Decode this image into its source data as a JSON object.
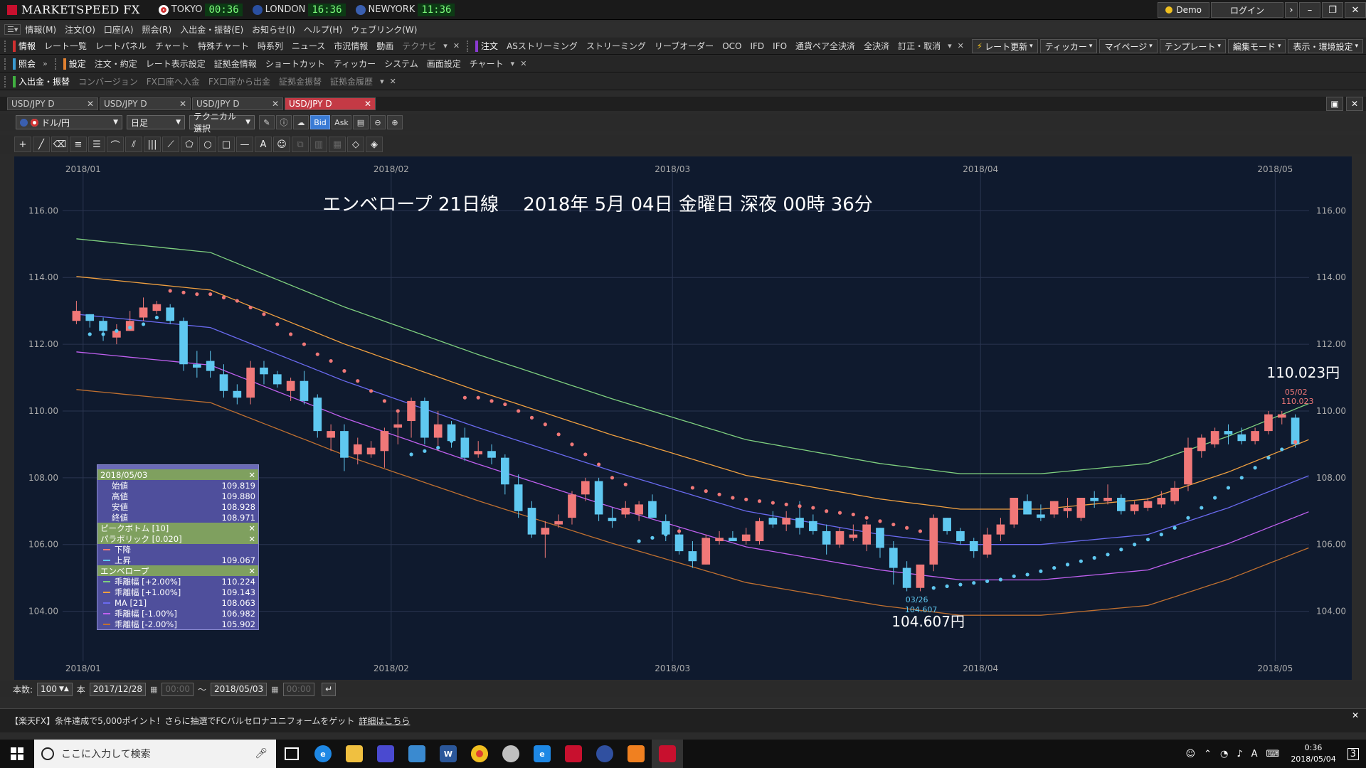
{
  "titlebar": {
    "brand": "MARKETSPEED FX",
    "markets": [
      {
        "name": "TOKYO",
        "time": "00:36",
        "color": "#d03030"
      },
      {
        "name": "LONDON",
        "time": "16:36",
        "color": "#2a4fa0"
      },
      {
        "name": "NEWYORK",
        "time": "11:36",
        "color": "#3a5fb0"
      }
    ],
    "demo_label": "Demo",
    "login_label": "ログイン"
  },
  "menu": [
    "情報(M)",
    "注文(O)",
    "口座(A)",
    "照会(R)",
    "入出金・振替(E)",
    "お知らせ(I)",
    "ヘルプ(H)",
    "ウェブリンク(W)"
  ],
  "toolbar1": {
    "info_head": "情報",
    "info_items": [
      "レート一覧",
      "レートパネル",
      "チャート",
      "特殊チャート",
      "時系列",
      "ニュース",
      "市況情報",
      "動画",
      "テクナビ"
    ],
    "order_head": "注文",
    "order_items": [
      "ASストリーミング",
      "ストリーミング",
      "リーブオーダー",
      "OCO",
      "IFD",
      "IFO",
      "通貨ペア全決済",
      "全決済",
      "訂正・取消"
    ],
    "right_buttons": [
      "レート更新",
      "ティッカー",
      "マイページ",
      "テンプレート",
      "編集モード",
      "表示・環境設定"
    ]
  },
  "toolbar2": {
    "inquiry_head": "照会",
    "settings_head": "設定",
    "settings_items": [
      "注文・約定",
      "レート表示設定",
      "証拠金情報",
      "ショートカット",
      "ティッカー",
      "システム",
      "画面設定",
      "チャート"
    ]
  },
  "toolbar3": {
    "deposit_head": "入出金・振替",
    "deposit_items": [
      "コンバージョン",
      "FX口座へ入金",
      "FX口座から出金",
      "証拠金振替",
      "証拠金履歴"
    ]
  },
  "tabs": [
    {
      "label": "USD/JPY D",
      "active": false
    },
    {
      "label": "USD/JPY D",
      "active": false
    },
    {
      "label": "USD/JPY D",
      "active": false
    },
    {
      "label": "USD/JPY D",
      "active": true
    }
  ],
  "chart_controls": {
    "pair": "ドル/円",
    "timeframe": "日足",
    "technical": "テクニカル選択",
    "bid_label": "Bid",
    "ask_label": "Ask"
  },
  "chart_data": {
    "type": "candlestick",
    "title": "エンベロープ 21日線　 2018年 5月 04日 金曜日 深夜 00時 36分",
    "x_labels": [
      "2018/01",
      "2018/02",
      "2018/03",
      "2018/04",
      "2018/05"
    ],
    "x_label_index": [
      1,
      24,
      45,
      68,
      90
    ],
    "ylim": [
      102.5,
      117.2
    ],
    "yticks": [
      "116.00",
      "114.00",
      "112.00",
      "110.00",
      "108.00",
      "106.00",
      "104.00"
    ],
    "ytick_values": [
      116,
      114,
      112,
      110,
      108,
      106,
      104
    ],
    "ohlc": [
      [
        112.7,
        113.3,
        112.6,
        113.0
      ],
      [
        112.9,
        112.9,
        112.5,
        112.7
      ],
      [
        112.7,
        112.8,
        112.1,
        112.4
      ],
      [
        112.2,
        112.6,
        112.0,
        112.4
      ],
      [
        112.4,
        113.0,
        112.4,
        112.7
      ],
      [
        112.8,
        113.4,
        112.7,
        113.1
      ],
      [
        113.0,
        113.3,
        112.9,
        113.2
      ],
      [
        113.1,
        113.2,
        112.6,
        112.7
      ],
      [
        112.7,
        112.8,
        111.2,
        111.4
      ],
      [
        111.4,
        111.8,
        111.0,
        111.3
      ],
      [
        111.5,
        111.8,
        111.0,
        111.2
      ],
      [
        111.1,
        111.4,
        110.4,
        110.6
      ],
      [
        110.6,
        110.8,
        110.2,
        110.4
      ],
      [
        110.4,
        111.5,
        110.2,
        111.3
      ],
      [
        111.3,
        111.5,
        110.8,
        111.1
      ],
      [
        111.1,
        111.2,
        110.7,
        110.8
      ],
      [
        110.6,
        111.0,
        110.3,
        110.9
      ],
      [
        110.9,
        111.2,
        110.2,
        110.3
      ],
      [
        110.4,
        110.5,
        109.2,
        109.4
      ],
      [
        109.2,
        109.6,
        108.8,
        109.4
      ],
      [
        109.4,
        109.6,
        108.2,
        108.6
      ],
      [
        108.7,
        109.2,
        108.4,
        109.0
      ],
      [
        108.7,
        109.1,
        108.6,
        108.9
      ],
      [
        108.8,
        109.5,
        108.3,
        109.4
      ],
      [
        109.5,
        110.0,
        109.0,
        109.6
      ],
      [
        109.7,
        110.4,
        109.2,
        110.3
      ],
      [
        110.3,
        110.4,
        109.0,
        109.2
      ],
      [
        109.2,
        110.0,
        108.8,
        109.6
      ],
      [
        109.6,
        109.7,
        108.9,
        109.1
      ],
      [
        109.2,
        109.5,
        108.5,
        108.6
      ],
      [
        108.7,
        109.1,
        108.6,
        108.8
      ],
      [
        108.8,
        109.0,
        108.4,
        108.6
      ],
      [
        108.6,
        108.7,
        107.5,
        107.8
      ],
      [
        107.8,
        108.1,
        106.8,
        107.0
      ],
      [
        107.1,
        107.3,
        106.2,
        106.3
      ],
      [
        106.3,
        106.7,
        105.6,
        106.5
      ],
      [
        106.6,
        106.9,
        106.5,
        106.7
      ],
      [
        106.8,
        107.6,
        106.6,
        107.5
      ],
      [
        107.5,
        108.0,
        107.3,
        107.9
      ],
      [
        107.9,
        108.0,
        106.7,
        106.9
      ],
      [
        106.8,
        107.1,
        106.5,
        106.7
      ],
      [
        106.9,
        107.3,
        106.8,
        107.1
      ],
      [
        106.9,
        107.3,
        106.7,
        107.2
      ],
      [
        107.3,
        107.5,
        106.8,
        106.8
      ],
      [
        106.7,
        106.9,
        106.1,
        106.3
      ],
      [
        106.3,
        106.5,
        105.7,
        105.8
      ],
      [
        105.8,
        106.1,
        105.3,
        105.5
      ],
      [
        105.4,
        106.3,
        105.4,
        106.2
      ],
      [
        106.1,
        106.4,
        106.0,
        106.2
      ],
      [
        106.2,
        106.4,
        106.1,
        106.1
      ],
      [
        106.1,
        106.5,
        106.0,
        106.3
      ],
      [
        106.1,
        106.8,
        106.0,
        106.7
      ],
      [
        106.8,
        107.0,
        106.5,
        106.6
      ],
      [
        106.6,
        107.0,
        106.4,
        106.8
      ],
      [
        106.8,
        107.3,
        106.3,
        106.5
      ],
      [
        106.7,
        106.9,
        106.3,
        106.4
      ],
      [
        106.4,
        106.6,
        105.7,
        106.0
      ],
      [
        106.0,
        106.5,
        105.9,
        106.4
      ],
      [
        106.2,
        106.6,
        106.1,
        106.3
      ],
      [
        106.0,
        106.7,
        105.8,
        106.6
      ],
      [
        106.5,
        106.5,
        105.6,
        105.9
      ],
      [
        105.9,
        106.1,
        104.8,
        105.3
      ],
      [
        105.3,
        105.5,
        104.6,
        104.7
      ],
      [
        104.7,
        105.3,
        104.6,
        105.4
      ],
      [
        105.4,
        106.9,
        105.2,
        106.8
      ],
      [
        106.8,
        106.8,
        106.3,
        106.4
      ],
      [
        106.4,
        106.5,
        106.0,
        106.1
      ],
      [
        106.1,
        106.2,
        105.6,
        105.8
      ],
      [
        105.7,
        106.5,
        105.6,
        106.3
      ],
      [
        106.3,
        106.8,
        106.1,
        106.6
      ],
      [
        106.6,
        107.4,
        106.5,
        107.4
      ],
      [
        107.3,
        107.5,
        106.9,
        106.9
      ],
      [
        106.9,
        107.2,
        106.7,
        106.8
      ],
      [
        106.9,
        107.3,
        106.8,
        107.3
      ],
      [
        107.0,
        107.4,
        106.8,
        107.1
      ],
      [
        106.8,
        107.4,
        106.7,
        107.4
      ],
      [
        107.4,
        107.6,
        107.1,
        107.3
      ],
      [
        107.3,
        107.8,
        107.2,
        107.4
      ],
      [
        107.4,
        107.5,
        106.9,
        107.0
      ],
      [
        107.0,
        107.3,
        106.9,
        107.2
      ],
      [
        107.1,
        107.4,
        107.0,
        107.3
      ],
      [
        107.2,
        107.6,
        107.1,
        107.4
      ],
      [
        107.3,
        107.9,
        107.2,
        107.7
      ],
      [
        107.8,
        109.2,
        107.6,
        108.9
      ],
      [
        108.8,
        109.3,
        108.6,
        109.2
      ],
      [
        109.0,
        109.5,
        108.9,
        109.4
      ],
      [
        109.4,
        109.6,
        109.0,
        109.3
      ],
      [
        109.3,
        109.5,
        109.0,
        109.1
      ],
      [
        109.1,
        109.5,
        109.0,
        109.4
      ],
      [
        109.4,
        110.0,
        109.3,
        109.9
      ],
      [
        109.8,
        110.0,
        109.6,
        109.9
      ],
      [
        109.8,
        109.9,
        108.9,
        109.0
      ]
    ],
    "parabolic_dots": [
      [
        1,
        112.3
      ],
      [
        2,
        112.3
      ],
      [
        3,
        112.4
      ],
      [
        4,
        112.5
      ],
      [
        5,
        112.6
      ],
      [
        6,
        112.8
      ],
      [
        7,
        113.6
      ],
      [
        8,
        113.55
      ],
      [
        9,
        113.5
      ],
      [
        10,
        113.5
      ],
      [
        11,
        113.4
      ],
      [
        12,
        113.3
      ],
      [
        13,
        113.1
      ],
      [
        14,
        112.9
      ],
      [
        15,
        112.6
      ],
      [
        16,
        112.3
      ],
      [
        17,
        112.0
      ],
      [
        18,
        111.7
      ],
      [
        19,
        111.5
      ],
      [
        20,
        111.2
      ],
      [
        21,
        110.9
      ],
      [
        22,
        110.6
      ],
      [
        23,
        110.3
      ],
      [
        24,
        110.0
      ],
      [
        25,
        108.7
      ],
      [
        26,
        108.8
      ],
      [
        27,
        108.9
      ],
      [
        28,
        109.1
      ],
      [
        29,
        110.4
      ],
      [
        30,
        110.4
      ],
      [
        31,
        110.3
      ],
      [
        32,
        110.2
      ],
      [
        33,
        110.0
      ],
      [
        34,
        109.8
      ],
      [
        35,
        109.6
      ],
      [
        36,
        109.3
      ],
      [
        37,
        109.0
      ],
      [
        38,
        108.7
      ],
      [
        39,
        108.4
      ],
      [
        40,
        108.0
      ],
      [
        41,
        107.8
      ],
      [
        42,
        106.1
      ],
      [
        43,
        106.2
      ],
      [
        44,
        106.3
      ],
      [
        45,
        106.4
      ],
      [
        46,
        107.7
      ],
      [
        47,
        107.6
      ],
      [
        48,
        107.5
      ],
      [
        49,
        107.4
      ],
      [
        50,
        107.35
      ],
      [
        51,
        107.3
      ],
      [
        52,
        107.25
      ],
      [
        53,
        107.2
      ],
      [
        54,
        107.15
      ],
      [
        55,
        107.1
      ],
      [
        56,
        107.0
      ],
      [
        57,
        106.95
      ],
      [
        58,
        106.9
      ],
      [
        59,
        106.8
      ],
      [
        60,
        106.7
      ],
      [
        61,
        106.6
      ],
      [
        62,
        106.5
      ],
      [
        63,
        106.4
      ],
      [
        64,
        104.7
      ],
      [
        65,
        104.75
      ],
      [
        66,
        104.8
      ],
      [
        67,
        104.85
      ],
      [
        68,
        104.9
      ],
      [
        69,
        104.95
      ],
      [
        70,
        105.05
      ],
      [
        71,
        105.1
      ],
      [
        72,
        105.2
      ],
      [
        73,
        105.3
      ],
      [
        74,
        105.4
      ],
      [
        75,
        105.5
      ],
      [
        76,
        105.6
      ],
      [
        77,
        105.7
      ],
      [
        78,
        105.85
      ],
      [
        79,
        106.0
      ],
      [
        80,
        106.15
      ],
      [
        81,
        106.3
      ],
      [
        82,
        106.5
      ],
      [
        83,
        106.8
      ],
      [
        84,
        107.1
      ],
      [
        85,
        107.4
      ],
      [
        86,
        107.7
      ],
      [
        87,
        108.0
      ],
      [
        88,
        108.3
      ],
      [
        89,
        108.6
      ],
      [
        90,
        108.85
      ],
      [
        91,
        109.07
      ]
    ],
    "envelope_ma": [
      [
        0,
        112.9
      ],
      [
        10,
        112.5
      ],
      [
        20,
        110.9
      ],
      [
        30,
        109.5
      ],
      [
        40,
        108.2
      ],
      [
        50,
        107.0
      ],
      [
        60,
        106.3
      ],
      [
        66,
        106.0
      ],
      [
        72,
        106.0
      ],
      [
        80,
        106.3
      ],
      [
        86,
        107.1
      ],
      [
        92,
        108.06
      ]
    ],
    "annotations": [
      {
        "text": "110.023円",
        "x": 90,
        "y": 110.023,
        "kind": "high"
      },
      {
        "text": "05/02",
        "x": 90,
        "y": 110.023,
        "kind": "high-date"
      },
      {
        "text": "110.023",
        "x": 90,
        "y": 110.023,
        "kind": "high-val"
      },
      {
        "text": "104.607円",
        "x": 62,
        "y": 104.607,
        "kind": "low"
      },
      {
        "text": "03/26",
        "x": 62,
        "y": 104.607,
        "kind": "low-date"
      },
      {
        "text": "104.607",
        "x": 62,
        "y": 104.607,
        "kind": "low-val"
      }
    ],
    "colors": {
      "up": "#f07878",
      "down": "#5fc8f0",
      "bg": "#0f1a2e",
      "grid": "#2a3550"
    }
  },
  "datawin": {
    "date": "2018/05/03",
    "ohlc": [
      {
        "label": "始値",
        "value": "109.819"
      },
      {
        "label": "高値",
        "value": "109.880"
      },
      {
        "label": "安値",
        "value": "108.928"
      },
      {
        "label": "終値",
        "value": "108.971"
      }
    ],
    "peak_bottom": "ピークボトム [10]",
    "parabolic": "パラボリック [0.020]",
    "parabolic_rows": [
      {
        "label": "下降",
        "value": "",
        "color": "#f07878"
      },
      {
        "label": "上昇",
        "value": "109.067",
        "color": "#5fc8f0"
      }
    ],
    "envelope": "エンベロープ",
    "envelope_rows": [
      {
        "label": "乖離幅 [+2.00%]",
        "value": "110.224",
        "color": "#7fd07f"
      },
      {
        "label": "乖離幅 [+1.00%]",
        "value": "109.143",
        "color": "#f0a040"
      },
      {
        "label": "MA [21]",
        "value": "108.063",
        "color": "#6a6af0"
      },
      {
        "label": "乖離幅 [-1.00%]",
        "value": "106.982",
        "color": "#c060f0"
      },
      {
        "label": "乖離幅 [-2.00%]",
        "value": "105.902",
        "color": "#c07030"
      }
    ]
  },
  "rangebar": {
    "count_label": "本数:",
    "count_value": "100",
    "unit": "本",
    "from_date": "2017/12/28",
    "from_time": "00:00",
    "tilde": "～",
    "to_date": "2018/05/03",
    "to_time": "00:00"
  },
  "news": {
    "text": "【楽天FX】条件達成で5,000ポイント！さらに抽選でFCバルセロナユニフォームをゲット",
    "link": "詳細はこちら"
  },
  "taskbar": {
    "search_placeholder": "ここに入力して検索",
    "time": "0:36",
    "date": "2018/05/04",
    "notif": "3"
  }
}
